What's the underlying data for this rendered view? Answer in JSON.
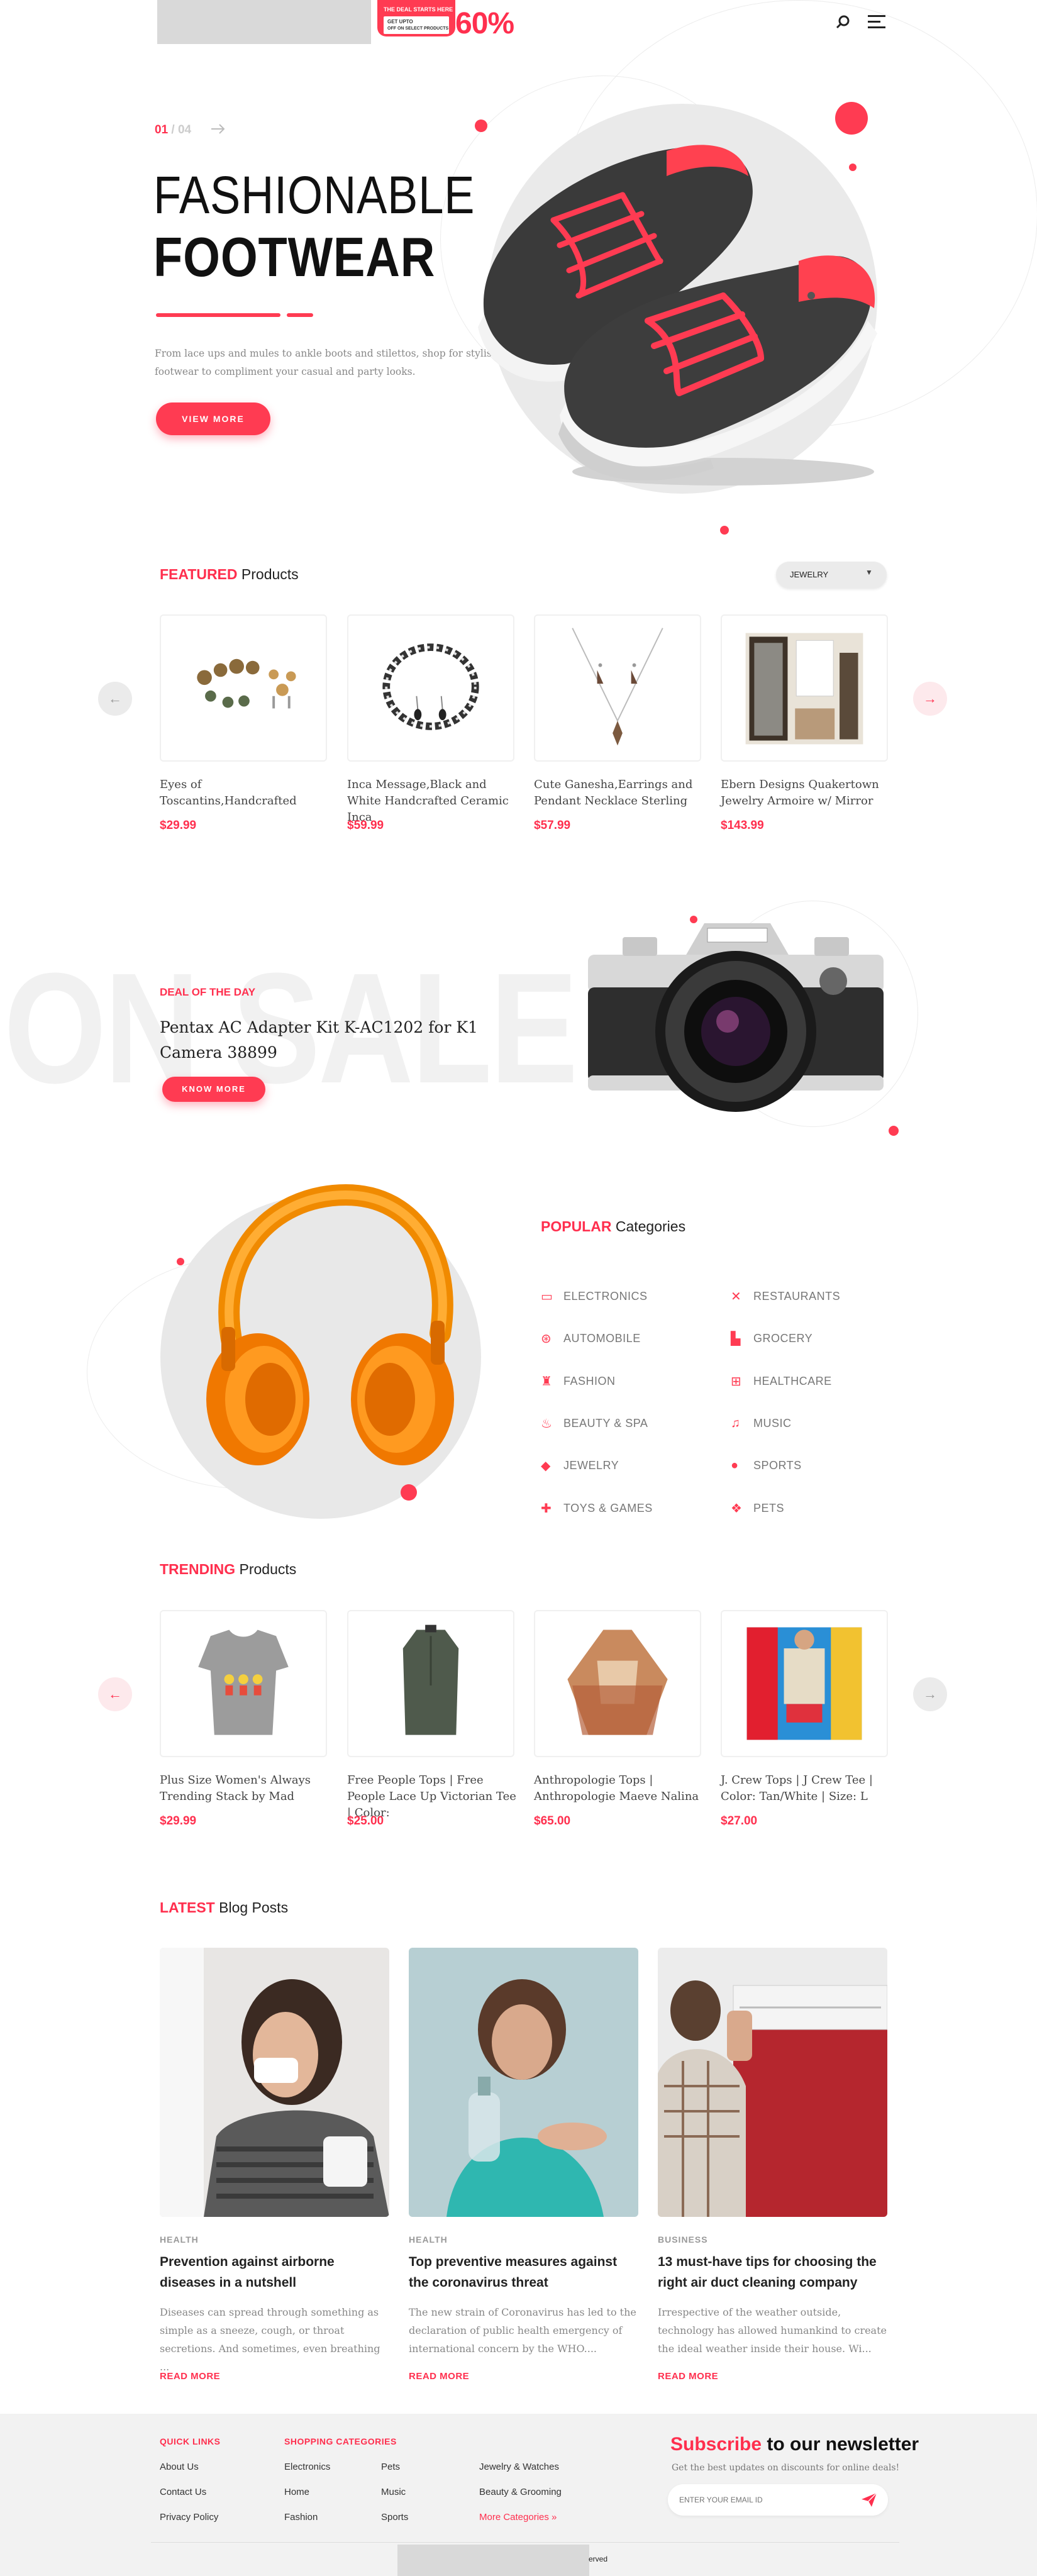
{
  "header": {
    "promo_line1": "THE DEAL STARTS HERE",
    "promo_line2": "GET UPTO",
    "promo_line3": "OFF ON SELECT PRODUCTS",
    "promo_percent": "60%"
  },
  "hero": {
    "slide_current": "01",
    "slide_total": "04",
    "title_light": "FASHIONABLE",
    "title_bold": "FOOTWEAR",
    "description": "From lace ups and mules to ankle boots and stilettos, shop for stylish footwear to compliment your casual and party looks.",
    "cta": "VIEW MORE"
  },
  "featured": {
    "title_accent": "FEATURED",
    "title_rest": "Products",
    "filter_value": "JEWELRY",
    "products": [
      {
        "name": "Eyes of Toscantins,Handcrafted",
        "price": "$29.99"
      },
      {
        "name": "Inca Message,Black and White Handcrafted Ceramic Inca",
        "price": "$59.99"
      },
      {
        "name": "Cute Ganesha,Earrings and Pendant Necklace Sterling",
        "price": "$57.99"
      },
      {
        "name": "Ebern Designs Quakertown Jewelry Armoire w/ Mirror",
        "price": "$143.99"
      }
    ]
  },
  "deal": {
    "bg_text": "ON SALE",
    "label": "DEAL OF THE DAY",
    "product": "Pentax AC Adapter Kit K-AC1202 for K1 Camera 38899",
    "cta": "KNOW MORE"
  },
  "popular": {
    "title_accent": "POPULAR",
    "title_rest": "Categories",
    "categories": [
      {
        "label": "ELECTRONICS",
        "icon": "monitor-icon"
      },
      {
        "label": "RESTAURANTS",
        "icon": "cutlery-icon"
      },
      {
        "label": "AUTOMOBILE",
        "icon": "wheel-icon"
      },
      {
        "label": "GROCERY",
        "icon": "shop-icon"
      },
      {
        "label": "FASHION",
        "icon": "dress-icon"
      },
      {
        "label": "HEALTHCARE",
        "icon": "first-aid-icon"
      },
      {
        "label": "BEAUTY & SPA",
        "icon": "spa-icon"
      },
      {
        "label": "MUSIC",
        "icon": "music-note-icon"
      },
      {
        "label": "JEWELRY",
        "icon": "diamond-icon"
      },
      {
        "label": "SPORTS",
        "icon": "basketball-icon"
      },
      {
        "label": "TOYS & GAMES",
        "icon": "puzzle-icon"
      },
      {
        "label": "PETS",
        "icon": "paw-icon"
      }
    ]
  },
  "trending": {
    "title_accent": "TRENDING",
    "title_rest": "Products",
    "products": [
      {
        "name": "Plus Size Women's Always Trending Stack by Mad",
        "price": "$29.99"
      },
      {
        "name": "Free People Tops | Free People Lace Up Victorian Tee | Color:",
        "price": "$25.00"
      },
      {
        "name": "Anthropologie Tops | Anthropologie Maeve Nalina",
        "price": "$65.00"
      },
      {
        "name": "J. Crew Tops | J Crew Tee | Color: Tan/White | Size: L",
        "price": "$27.00"
      }
    ]
  },
  "blog": {
    "title_accent": "LATEST",
    "title_rest": "Blog Posts",
    "read_more": "READ MORE",
    "posts": [
      {
        "category": "HEALTH",
        "title": "Prevention against airborne diseases in a nutshell",
        "excerpt": "Diseases can spread through something as simple as a sneeze, cough, or throat secretions. And sometimes, even breathing ..."
      },
      {
        "category": "HEALTH",
        "title": "Top preventive measures against the coronavirus threat",
        "excerpt": "The new strain of Coronavirus has led to the declaration of public health emergency of international concern by the WHO...."
      },
      {
        "category": "BUSINESS",
        "title": "13 must-have tips for choosing the right air duct cleaning company",
        "excerpt": "Irrespective of the weather outside, technology has allowed humankind to create the ideal weather inside their house. Wi..."
      }
    ]
  },
  "footer": {
    "quick_links_title": "QUICK LINKS",
    "quick_links": [
      "About Us",
      "Contact Us",
      "Privacy Policy"
    ],
    "shopping_title": "SHOPPING CATEGORIES",
    "shop_col1": [
      "Electronics",
      "Home",
      "Fashion"
    ],
    "shop_col2": [
      "Pets",
      "Music",
      "Sports"
    ],
    "shop_col3": [
      "Jewelry & Watches",
      "Beauty & Grooming",
      "More Categories »"
    ],
    "newsletter_accent": "Subscribe",
    "newsletter_rest": "to our newsletter",
    "newsletter_sub": "Get the best updates on discounts for online deals!",
    "email_placeholder": "ENTER YOUR EMAIL ID",
    "copyright_fragment": "erved"
  },
  "colors": {
    "accent": "#ff2f4e",
    "footer_bg": "#f2f2f2",
    "text": "#222222"
  }
}
